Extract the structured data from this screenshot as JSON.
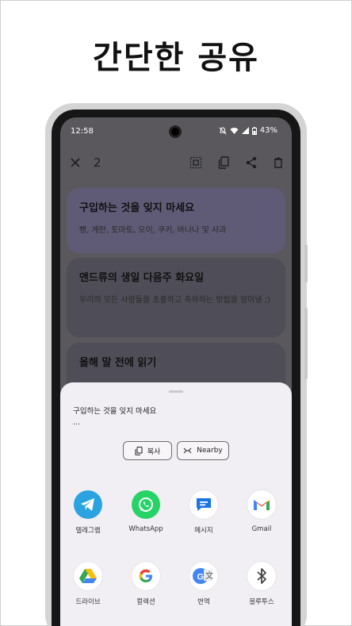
{
  "headline": "간단한 공유",
  "status": {
    "time": "12:58",
    "battery": "43%"
  },
  "toolbar": {
    "selected_count": "2"
  },
  "notes": [
    {
      "title": "구입하는 것을 잊지 마세요",
      "body": "빵, 계란, 토마토, 오이, 쿠키, 바나나 및 사과"
    },
    {
      "title": "앤드류의 생일 다음주 화요일",
      "body": "우리의 모든 사람들을 초출하고 축하하는 방법을 알아낼 ;)"
    },
    {
      "title": "올해 말 전에 읽기",
      "body": ""
    }
  ],
  "share": {
    "preview_line1": "구입하는 것을 잊지 마세요",
    "preview_line2": "...",
    "copy_label": "복사",
    "nearby_label": "Nearby",
    "apps": [
      {
        "label": "텔레그램",
        "icon": "telegram-icon",
        "color": "#2aa3e0"
      },
      {
        "label": "WhatsApp",
        "icon": "whatsapp-icon",
        "color": "#25d366"
      },
      {
        "label": "메시지",
        "icon": "messages-icon",
        "color": "#1a73e8"
      },
      {
        "label": "Gmail",
        "icon": "gmail-icon",
        "color": "#ea4335"
      },
      {
        "label": "드라이브",
        "icon": "drive-icon",
        "color": "#34a853"
      },
      {
        "label": "컬렉션",
        "icon": "google-icon",
        "color": "#4285f4"
      },
      {
        "label": "번역",
        "icon": "translate-icon",
        "color": "#4285f4"
      },
      {
        "label": "블루투스",
        "icon": "bluetooth-icon",
        "color": "#444444"
      }
    ]
  }
}
